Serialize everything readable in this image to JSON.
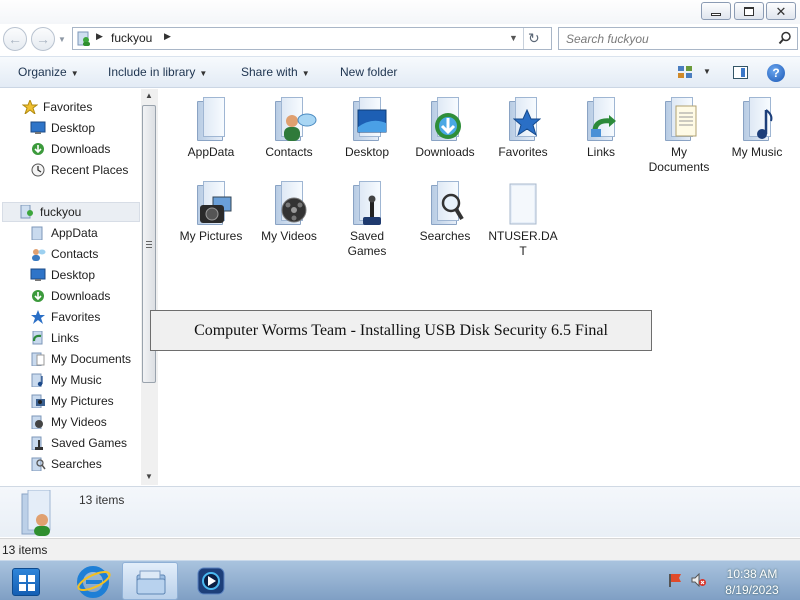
{
  "window": {
    "title_buttons": {
      "minimize": "minimize",
      "maximize": "restore",
      "close": "close"
    }
  },
  "nav": {
    "address_path": "fuckyou",
    "search_placeholder": "Search fuckyou"
  },
  "commands": {
    "organize": "Organize",
    "include_in_library": "Include in library",
    "share_with": "Share with",
    "new_folder": "New folder"
  },
  "tree": {
    "favorites_header": "Favorites",
    "favorites": [
      {
        "label": "Desktop",
        "icon": "desktop-icon"
      },
      {
        "label": "Downloads",
        "icon": "downloads-icon"
      },
      {
        "label": "Recent Places",
        "icon": "recent-places-icon"
      }
    ],
    "root": "fuckyou",
    "children": [
      {
        "label": "AppData",
        "icon": "folder-icon"
      },
      {
        "label": "Contacts",
        "icon": "contacts-icon"
      },
      {
        "label": "Desktop",
        "icon": "desktop-icon"
      },
      {
        "label": "Downloads",
        "icon": "downloads-icon"
      },
      {
        "label": "Favorites",
        "icon": "favorites-icon"
      },
      {
        "label": "Links",
        "icon": "links-icon"
      },
      {
        "label": "My Documents",
        "icon": "documents-icon"
      },
      {
        "label": "My Music",
        "icon": "music-icon"
      },
      {
        "label": "My Pictures",
        "icon": "pictures-icon"
      },
      {
        "label": "My Videos",
        "icon": "videos-icon"
      },
      {
        "label": "Saved Games",
        "icon": "saved-games-icon"
      },
      {
        "label": "Searches",
        "icon": "searches-icon"
      }
    ]
  },
  "files": [
    {
      "label": "AppData",
      "icon": "folder-icon"
    },
    {
      "label": "Contacts",
      "icon": "contacts-folder-icon"
    },
    {
      "label": "Desktop",
      "icon": "desktop-folder-icon"
    },
    {
      "label": "Downloads",
      "icon": "downloads-folder-icon"
    },
    {
      "label": "Favorites",
      "icon": "favorites-folder-icon"
    },
    {
      "label": "Links",
      "icon": "links-folder-icon"
    },
    {
      "label": "My Documents",
      "icon": "documents-folder-icon"
    },
    {
      "label": "My Music",
      "icon": "music-folder-icon"
    },
    {
      "label": "My Pictures",
      "icon": "pictures-folder-icon"
    },
    {
      "label": "My Videos",
      "icon": "videos-folder-icon"
    },
    {
      "label": "Saved Games",
      "icon": "saved-games-folder-icon"
    },
    {
      "label": "Searches",
      "icon": "searches-folder-icon"
    },
    {
      "label": "NTUSER.DAT",
      "icon": "file-icon"
    }
  ],
  "overlay": {
    "text": "Computer Worms Team - Installing USB Disk Security 6.5 Final"
  },
  "details": {
    "count": "13 items"
  },
  "status": {
    "text": "13 items"
  },
  "taskbar": {
    "time": "10:38 AM",
    "date": "8/19/2023"
  }
}
